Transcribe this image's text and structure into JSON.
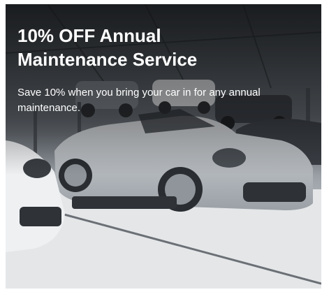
{
  "promo": {
    "title_line1": "10% OFF Annual",
    "title_line2": "Maintenance Service",
    "description_line1": "Save 10% when you bring your car in for any annual",
    "description_line2": "maintenance."
  },
  "colors": {
    "text": "#ffffff",
    "car_body": "#c9ccd0",
    "floor": "#e6e8ea"
  }
}
